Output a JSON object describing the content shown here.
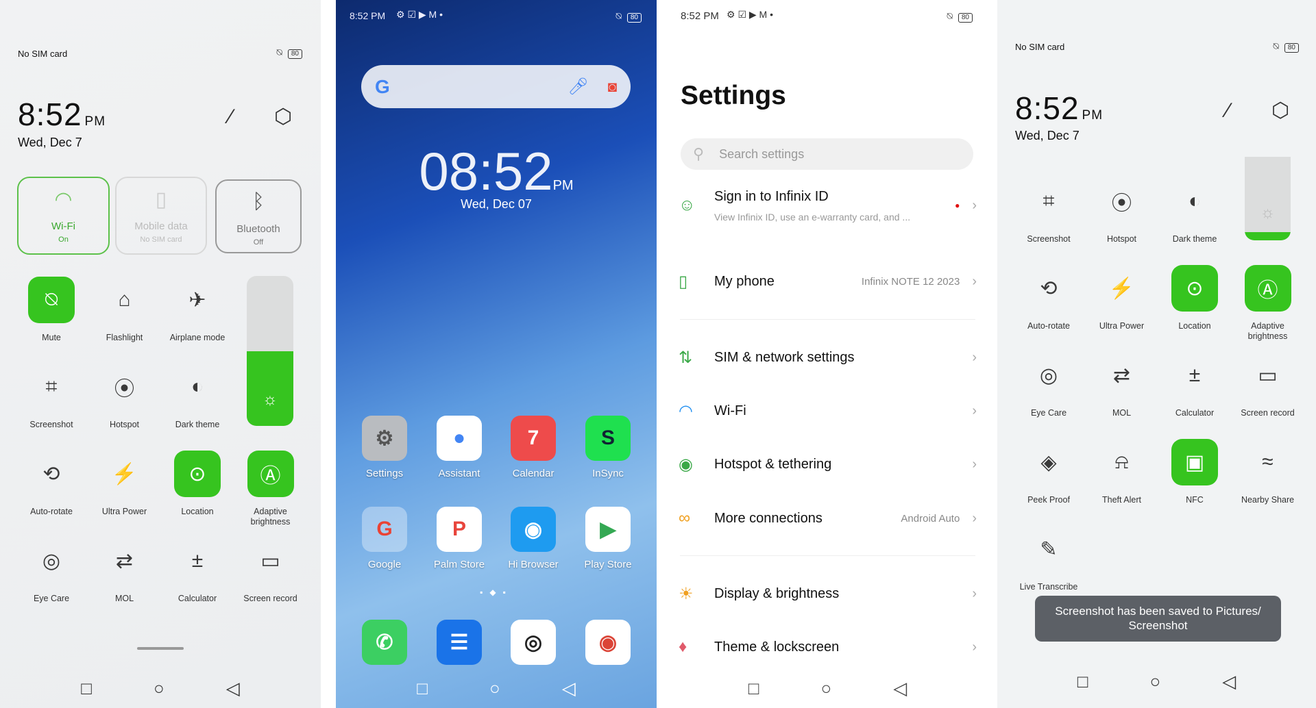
{
  "colors": {
    "accent": "#36c41f",
    "toast": "#5c6066"
  },
  "panel1": {
    "status": {
      "carrier": "No SIM card",
      "battery": "80"
    },
    "clock": {
      "time": "8:52",
      "ampm": "PM",
      "date": "Wed, Dec 7"
    },
    "header_icons": [
      "edit-icon",
      "settings-icon"
    ],
    "big_tiles": [
      {
        "title": "Wi-Fi",
        "sub": "On",
        "icon": "wifi-icon",
        "state": "on"
      },
      {
        "title": "Mobile data",
        "sub": "No SIM card",
        "icon": "sim-icon",
        "state": "disabled"
      },
      {
        "title": "Bluetooth",
        "sub": "Off",
        "icon": "bluetooth-icon",
        "state": "off"
      }
    ],
    "grid": [
      [
        {
          "label": "Mute",
          "icon": "mute-icon",
          "on": true
        },
        {
          "label": "Flashlight",
          "icon": "flashlight-icon"
        },
        {
          "label": "Airplane mode",
          "icon": "airplane-icon"
        }
      ],
      [
        {
          "label": "Screenshot",
          "icon": "screenshot-icon"
        },
        {
          "label": "Hotspot",
          "icon": "hotspot-icon"
        },
        {
          "label": "Dark theme",
          "icon": "dark-theme-icon"
        }
      ],
      [
        {
          "label": "Auto-rotate",
          "icon": "auto-rotate-icon"
        },
        {
          "label": "Ultra Power",
          "icon": "ultra-power-icon"
        },
        {
          "label": "Location",
          "icon": "location-icon",
          "on": true
        },
        {
          "label": "Adaptive brightness",
          "icon": "adaptive-brightness-icon",
          "on": true
        }
      ],
      [
        {
          "label": "Eye Care",
          "icon": "eye-care-icon"
        },
        {
          "label": "MOL",
          "icon": "mol-icon"
        },
        {
          "label": "Calculator",
          "icon": "calculator-icon"
        },
        {
          "label": "Screen record",
          "icon": "screen-record-icon"
        }
      ]
    ],
    "brightness_percent": 50
  },
  "panel2": {
    "status": {
      "time": "8:52 PM",
      "battery": "80"
    },
    "clock": {
      "time": "08:52",
      "ampm": "PM",
      "date": "Wed, Dec 07"
    },
    "apps": [
      {
        "label": "Settings",
        "icon": "settings-app-icon",
        "bg": "#b9bcc0",
        "fg": "#555",
        "glyph": "⚙"
      },
      {
        "label": "Assistant",
        "icon": "assistant-app-icon",
        "bg": "#ffffff",
        "fg": "#4285f4",
        "glyph": "●"
      },
      {
        "label": "Calendar",
        "icon": "calendar-app-icon",
        "bg": "#ee4b4b",
        "fg": "#fff",
        "glyph": "7"
      },
      {
        "label": "InSync",
        "icon": "insync-app-icon",
        "bg": "#1fe04f",
        "fg": "#123",
        "glyph": "S"
      },
      {
        "label": "Google",
        "icon": "google-folder-icon",
        "bg": "rgba(255,255,255,.35)",
        "fg": "#ea4335",
        "glyph": "G"
      },
      {
        "label": "Palm Store",
        "icon": "palm-store-app-icon",
        "bg": "#ffffff",
        "fg": "#e8453c",
        "glyph": "P"
      },
      {
        "label": "Hi Browser",
        "icon": "hi-browser-app-icon",
        "bg": "#1e9bf0",
        "fg": "#fff",
        "glyph": "◉"
      },
      {
        "label": "Play Store",
        "icon": "play-store-app-icon",
        "bg": "#ffffff",
        "fg": "#34a853",
        "glyph": "▶"
      }
    ],
    "dock": [
      {
        "icon": "phone-app-icon",
        "bg": "#3ccf62",
        "fg": "#fff",
        "glyph": "✆"
      },
      {
        "icon": "messages-app-icon",
        "bg": "#1a73e8",
        "fg": "#fff",
        "glyph": "☰"
      },
      {
        "icon": "camera-app-icon",
        "bg": "#ffffff",
        "fg": "#222",
        "glyph": "◎"
      },
      {
        "icon": "chrome-app-icon",
        "bg": "#ffffff",
        "fg": "#db4437",
        "glyph": "◉"
      }
    ]
  },
  "panel3": {
    "status": {
      "time": "8:52 PM",
      "battery": "80"
    },
    "title": "Settings",
    "search_placeholder": "Search settings",
    "items": [
      {
        "title": "Sign in to Infinix ID",
        "sub": "View Infinix ID, use an e-warranty card, and ...",
        "icon": "account-icon",
        "glyph": "☺",
        "color": "#3aa847"
      },
      {
        "title": "My phone",
        "value": "Infinix NOTE 12 2023",
        "icon": "phone-icon",
        "glyph": "▯",
        "color": "#3aa847"
      },
      {
        "title": "SIM & network settings",
        "icon": "sim-network-icon",
        "glyph": "⇅",
        "color": "#3aa847"
      },
      {
        "title": "Wi-Fi",
        "icon": "wifi-icon",
        "glyph": "◠",
        "color": "#1a8cf0"
      },
      {
        "title": "Hotspot & tethering",
        "icon": "hotspot-icon",
        "glyph": "◉",
        "color": "#3aa847"
      },
      {
        "title": "More connections",
        "value": "Android Auto",
        "icon": "connections-icon",
        "glyph": "∞",
        "color": "#f0a020"
      },
      {
        "title": "Display & brightness",
        "icon": "display-icon",
        "glyph": "☀",
        "color": "#f0a020"
      },
      {
        "title": "Theme & lockscreen",
        "icon": "theme-icon",
        "glyph": "♦",
        "color": "#e05a6a"
      }
    ]
  },
  "panel4": {
    "status": {
      "carrier": "No SIM card",
      "battery": "80"
    },
    "clock": {
      "time": "8:52",
      "ampm": "PM",
      "date": "Wed, Dec 7"
    },
    "grid": [
      [
        {
          "label": "Screenshot",
          "icon": "screenshot-icon"
        },
        {
          "label": "Hotspot",
          "icon": "hotspot-icon"
        },
        {
          "label": "Dark theme",
          "icon": "dark-theme-icon"
        }
      ],
      [
        {
          "label": "Auto-rotate",
          "icon": "auto-rotate-icon"
        },
        {
          "label": "Ultra Power",
          "icon": "ultra-power-icon"
        },
        {
          "label": "Location",
          "icon": "location-icon",
          "on": true
        },
        {
          "label": "Adaptive brightness",
          "icon": "adaptive-brightness-icon",
          "on": true
        }
      ],
      [
        {
          "label": "Eye Care",
          "icon": "eye-care-icon"
        },
        {
          "label": "MOL",
          "icon": "mol-icon"
        },
        {
          "label": "Calculator",
          "icon": "calculator-icon"
        },
        {
          "label": "Screen record",
          "icon": "screen-record-icon"
        }
      ],
      [
        {
          "label": "Peek Proof",
          "icon": "peek-proof-icon"
        },
        {
          "label": "Theft Alert",
          "icon": "theft-alert-icon"
        },
        {
          "label": "NFC",
          "icon": "nfc-icon",
          "on": true
        },
        {
          "label": "Nearby Share",
          "icon": "nearby-share-icon"
        }
      ],
      [
        {
          "label": "Live Transcribe",
          "icon": "live-transcribe-icon"
        }
      ]
    ],
    "brightness_percent": 10,
    "toast": "Screenshot has been saved to  Pictures/ Screenshot"
  }
}
